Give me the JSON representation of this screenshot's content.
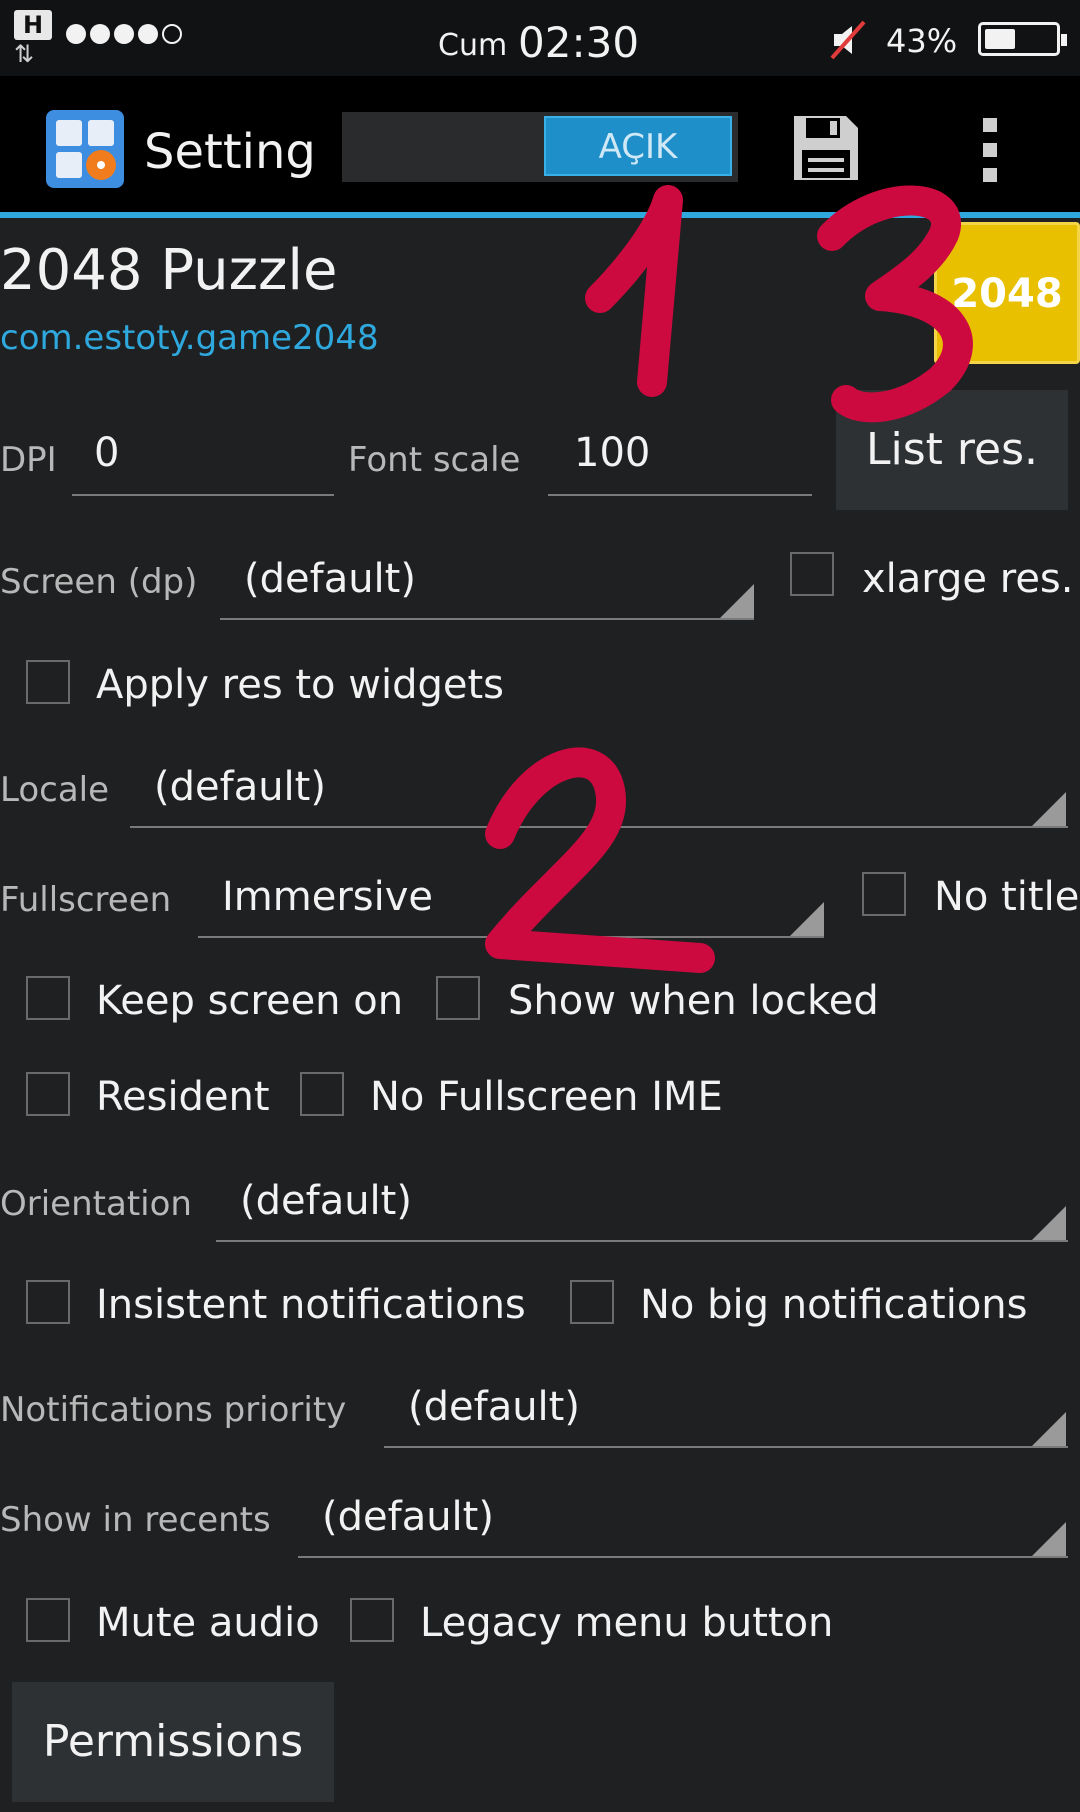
{
  "status_bar": {
    "h_label": "H",
    "arrows": "⇅",
    "day": "Cum",
    "time": "02:30",
    "battery": "43%",
    "battery_level": 0.43
  },
  "action_bar": {
    "title": "Setting",
    "toggle_label": "AÇIK"
  },
  "app": {
    "name": "2048 Puzzle",
    "package": "com.estoty.game2048",
    "icon_text": "2048"
  },
  "form": {
    "dpi_label": "DPI",
    "dpi_value": "0",
    "font_scale_label": "Font scale",
    "font_scale_value": "100",
    "list_res_button": "List res.",
    "screen_label": "Screen (dp)",
    "screen_value": "(default)",
    "xlarge_label": "xlarge res.",
    "apply_res_label": "Apply res to widgets",
    "locale_label": "Locale",
    "locale_value": "(default)",
    "fullscreen_label": "Fullscreen",
    "fullscreen_value": "Immersive",
    "no_title_label": "No title",
    "keep_screen_on_label": "Keep screen on",
    "show_when_locked_label": "Show when locked",
    "resident_label": "Resident",
    "no_fullscreen_ime_label": "No Fullscreen IME",
    "orientation_label": "Orientation",
    "orientation_value": "(default)",
    "insistent_label": "Insistent notifications",
    "no_big_label": "No big notifications",
    "notif_priority_label": "Notifications priority",
    "notif_priority_value": "(default)",
    "show_in_recents_label": "Show in recents",
    "show_in_recents_value": "(default)",
    "mute_audio_label": "Mute audio",
    "legacy_menu_label": "Legacy menu button",
    "permissions_button": "Permissions"
  },
  "annotations": {
    "color": "#cc0a3f",
    "labels": [
      "1",
      "2",
      "3"
    ]
  }
}
